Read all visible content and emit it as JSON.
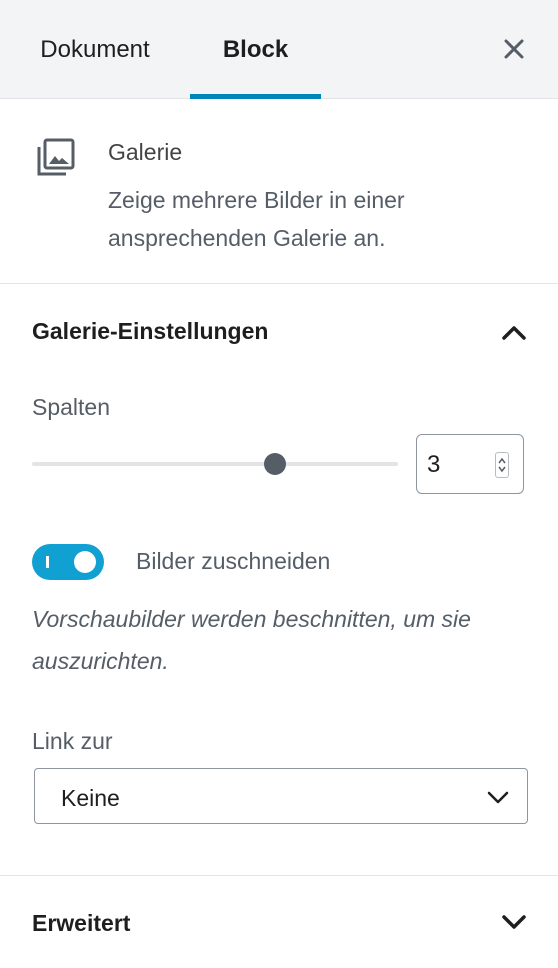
{
  "tabs": {
    "document": "Dokument",
    "block": "Block",
    "close_icon": "close-icon"
  },
  "block_info": {
    "icon": "gallery-icon",
    "title": "Galerie",
    "description": "Zeige mehrere Bilder in einer ansprechenden Galerie an."
  },
  "gallery_settings": {
    "title": "Galerie-Einstellungen",
    "expanded": true,
    "columns": {
      "label": "Spalten",
      "value": "3",
      "min": 1,
      "max": 5
    },
    "crop": {
      "label": "Bilder zuschneiden",
      "enabled": true,
      "help": "Vorschaubilder werden beschnitten, um sie auszurichten."
    },
    "link": {
      "label": "Link zur",
      "selected": "Keine"
    }
  },
  "advanced": {
    "title": "Erweitert",
    "expanded": false
  },
  "colors": {
    "accent": "#0085ba",
    "toggle_on": "#11a0d2"
  }
}
